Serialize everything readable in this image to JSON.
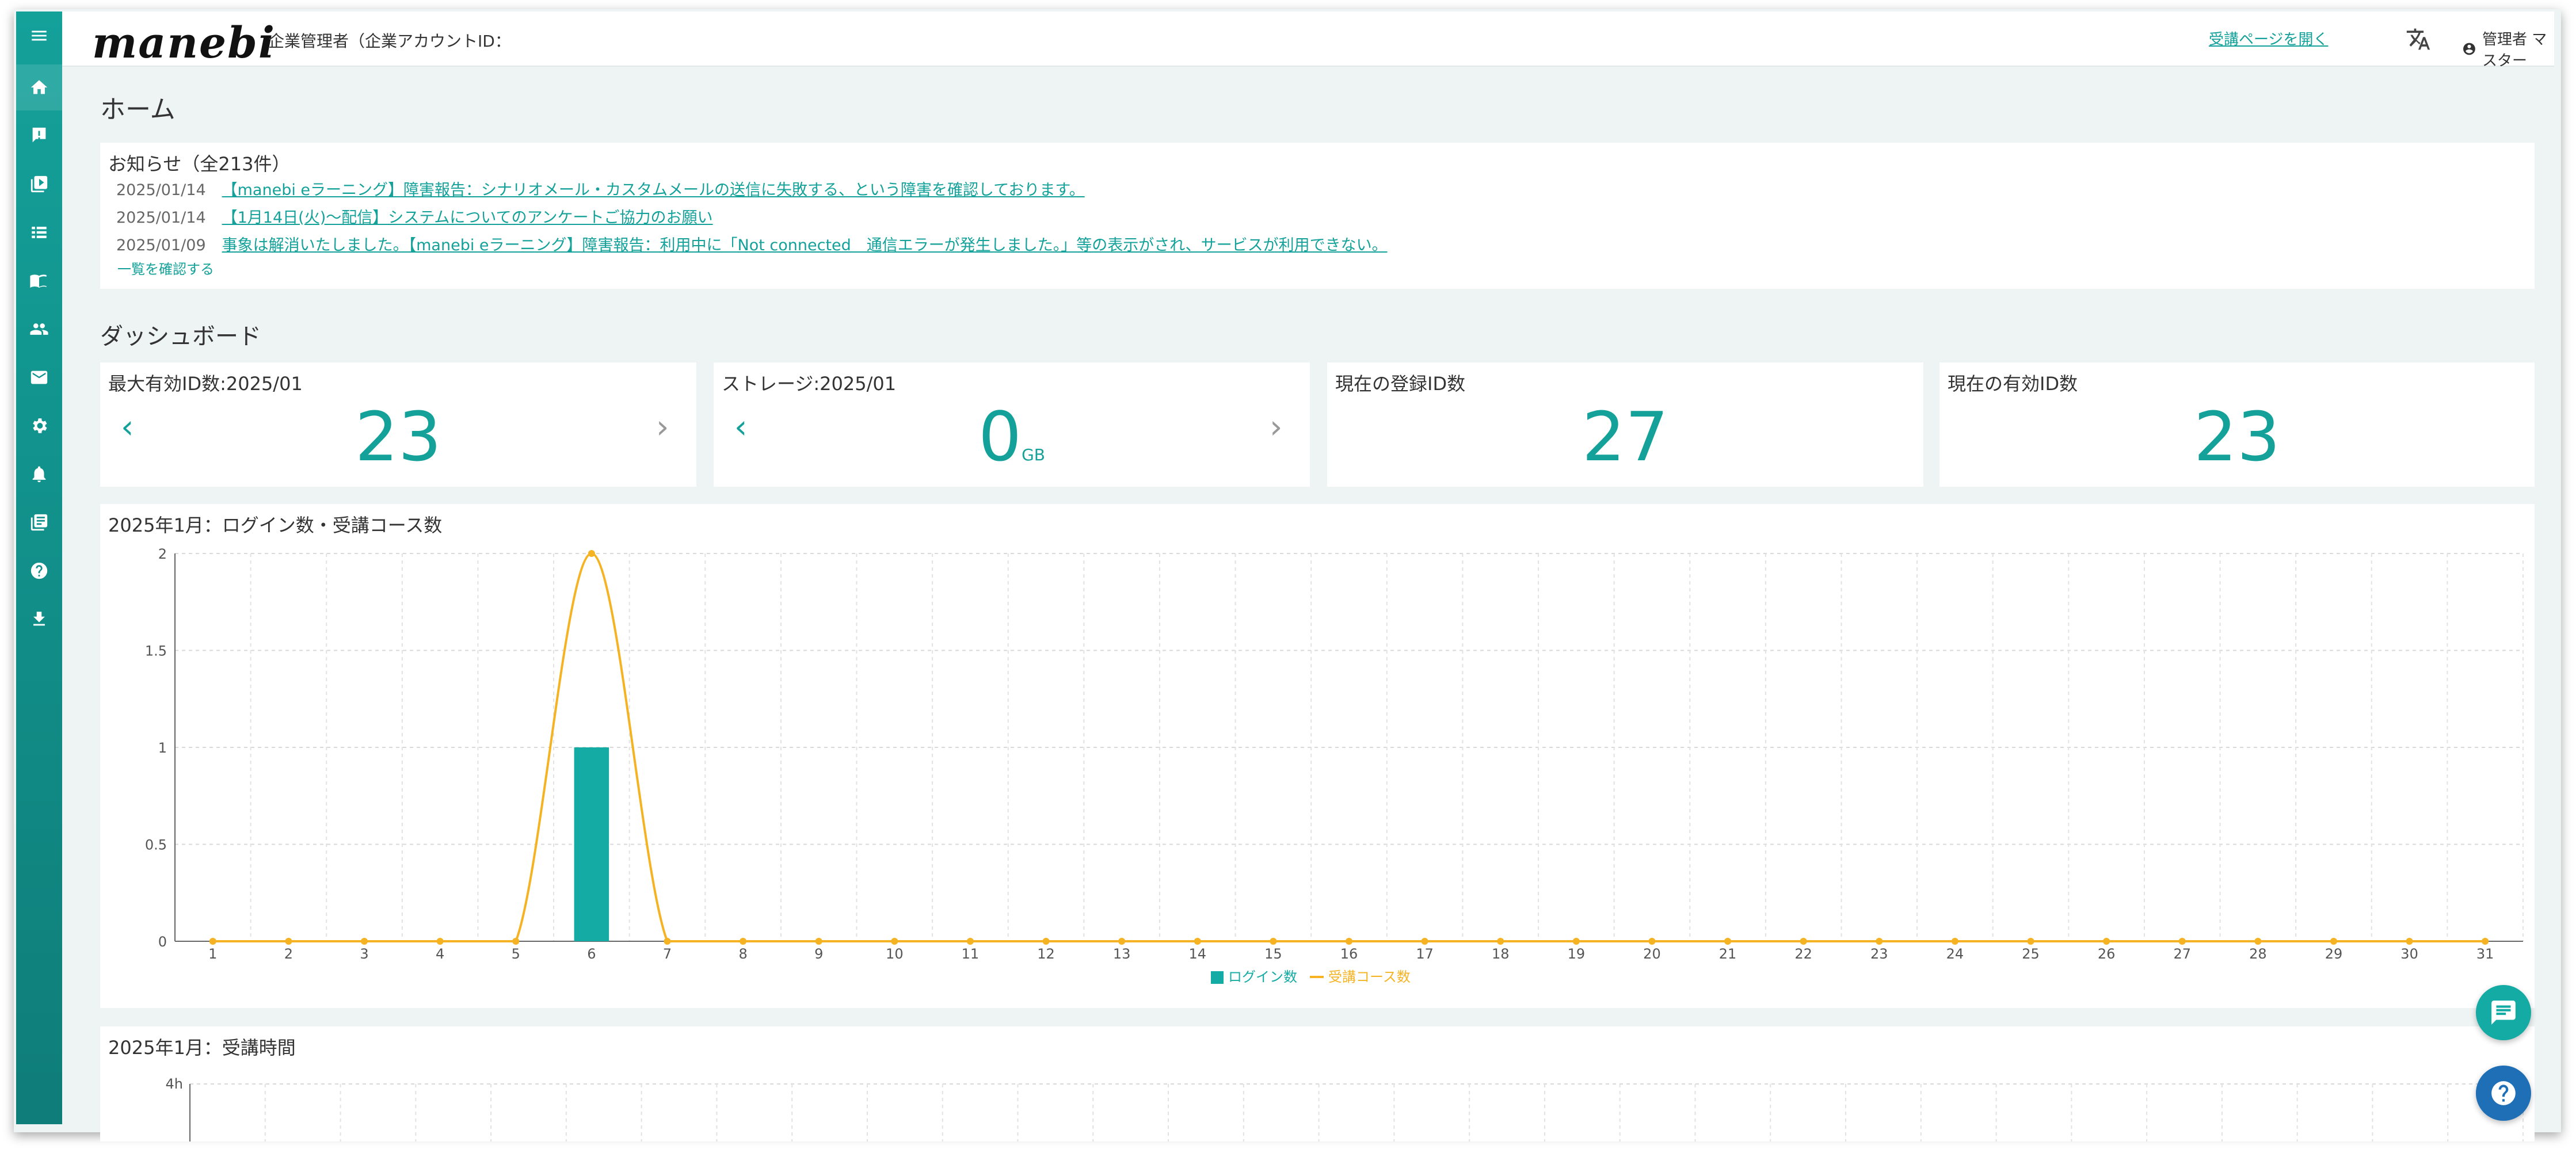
{
  "app": {
    "logo": "manebi",
    "account_label": "企業管理者（企業アカウントID："
  },
  "header": {
    "open_learner_page": "受講ページを開く",
    "user": "管理者 マスター"
  },
  "sidebar": {
    "icons": [
      "menu-icon",
      "home-icon",
      "feedback-icon",
      "video-library-icon",
      "list-icon",
      "book-icon",
      "users-icon",
      "mail-icon",
      "gear-icon",
      "bell-icon",
      "library-books-icon",
      "help-icon",
      "download-icon"
    ]
  },
  "page": {
    "title": "ホーム"
  },
  "news": {
    "title": "お知らせ（全213件）",
    "items": [
      {
        "date": "2025/01/14",
        "text": "【manebi eラーニング】障害報告：シナリオメール・カスタムメールの送信に失敗する、という障害を確認しております。"
      },
      {
        "date": "2025/01/14",
        "text": "【1月14日(火)〜配信】システムについてのアンケートご協力のお願い"
      },
      {
        "date": "2025/01/09",
        "text": "事象は解消いたしました。【manebi eラーニング】障害報告：利用中に「Not connected　通信エラーが発生しました。」等の表示がされ、サービスが利用できない。"
      }
    ],
    "see_all": "一覧を確認する"
  },
  "dashboard": {
    "title": "ダッシュボード",
    "stats": [
      {
        "label": "最大有効ID数:2025/01",
        "value": "23",
        "unit": "",
        "has_arrows": true
      },
      {
        "label": "ストレージ:2025/01",
        "value": "0",
        "unit": "GB",
        "has_arrows": true
      },
      {
        "label": "現在の登録ID数",
        "value": "27",
        "unit": "",
        "has_arrows": false
      },
      {
        "label": "現在の有効ID数",
        "value": "23",
        "unit": "",
        "has_arrows": false
      }
    ]
  },
  "chart_data": [
    {
      "type": "bar",
      "title": "2025年1月：ログイン数・受講コース数",
      "categories": [
        "1",
        "2",
        "3",
        "4",
        "5",
        "6",
        "7",
        "8",
        "9",
        "10",
        "11",
        "12",
        "13",
        "14",
        "15",
        "16",
        "17",
        "18",
        "19",
        "20",
        "21",
        "22",
        "23",
        "24",
        "25",
        "26",
        "27",
        "28",
        "29",
        "30",
        "31"
      ],
      "ylim": [
        0,
        2
      ],
      "yticks": [
        "0",
        "0.5",
        "1",
        "1.5",
        "2"
      ],
      "grid": true,
      "legend": "bottom-center",
      "series": [
        {
          "name": "ログイン数",
          "type": "bar",
          "color": "#13aba3",
          "values": [
            0,
            0,
            0,
            0,
            0,
            1,
            0,
            0,
            0,
            0,
            0,
            0,
            0,
            0,
            0,
            0,
            0,
            0,
            0,
            0,
            0,
            0,
            0,
            0,
            0,
            0,
            0,
            0,
            0,
            0,
            0
          ]
        },
        {
          "name": "受講コース数",
          "type": "line",
          "color": "#f5b324",
          "values": [
            0,
            0,
            0,
            0,
            0,
            2,
            0,
            0,
            0,
            0,
            0,
            0,
            0,
            0,
            0,
            0,
            0,
            0,
            0,
            0,
            0,
            0,
            0,
            0,
            0,
            0,
            0,
            0,
            0,
            0,
            0
          ]
        }
      ]
    },
    {
      "type": "line",
      "title": "2025年1月：受講時間",
      "yticks": [
        "4h"
      ],
      "grid": true
    }
  ]
}
